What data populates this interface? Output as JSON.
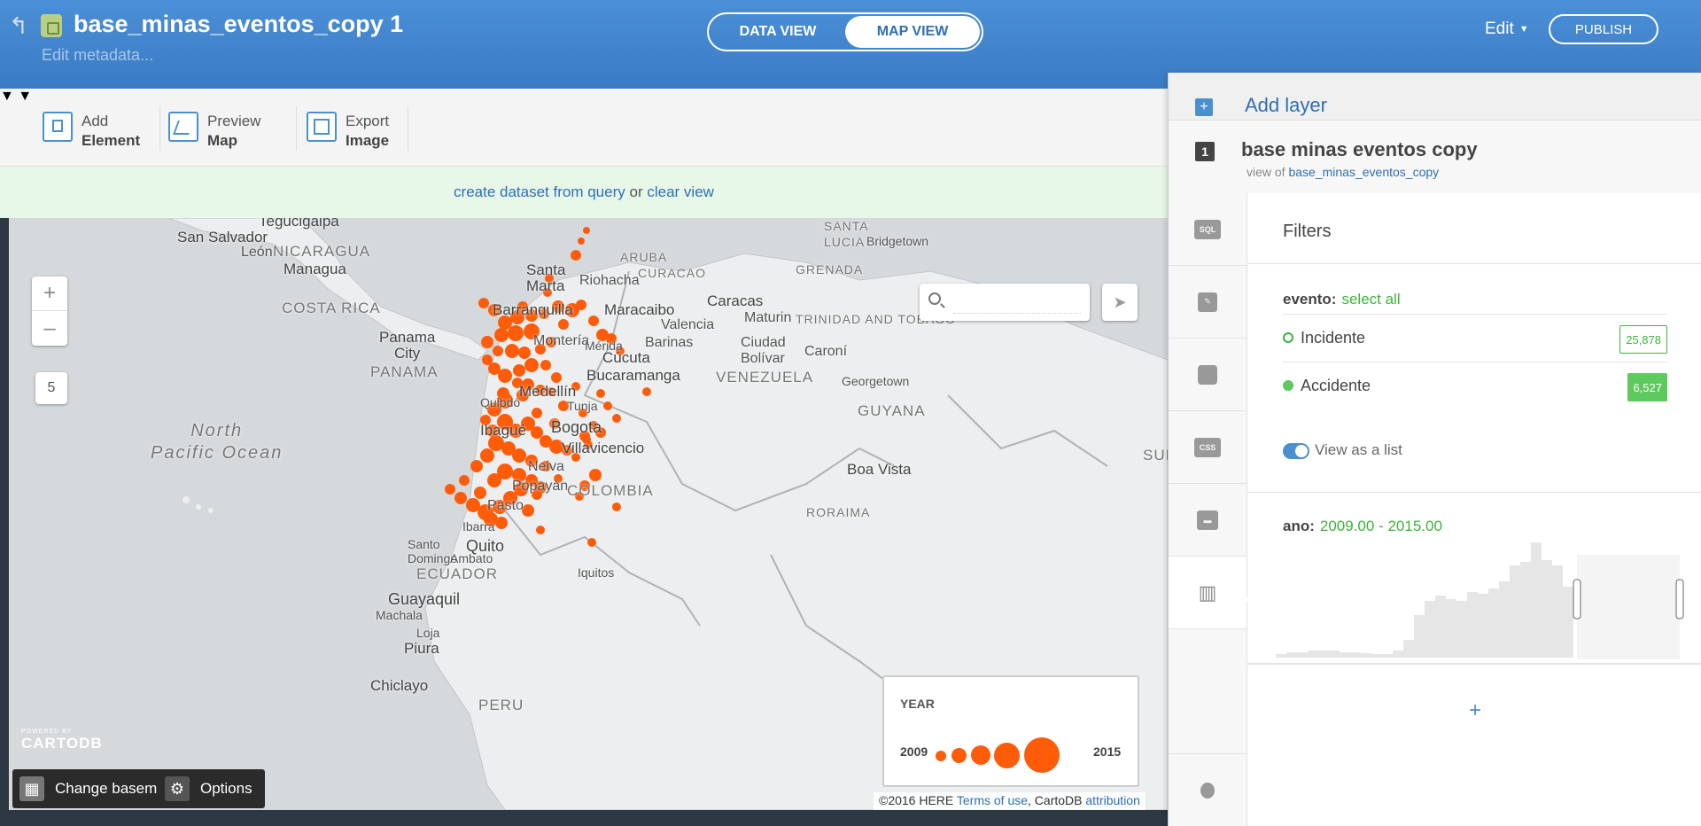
{
  "header": {
    "title": "base_minas_eventos_copy 1",
    "subtitle": "Edit metadata...",
    "tabs": [
      "DATA VIEW",
      "MAP VIEW"
    ],
    "active_tab": "MAP VIEW",
    "edit_label": "Edit",
    "publish_label": "PUBLISH"
  },
  "toolbar": {
    "add": {
      "line1": "Add",
      "line2": "Element"
    },
    "preview": {
      "line1": "Preview",
      "line2": "Map"
    },
    "export": {
      "line1": "Export",
      "line2": "Image"
    }
  },
  "banner": {
    "link1": "create dataset from query",
    "middle": "or",
    "link2": "clear view"
  },
  "map": {
    "zoom_in": "+",
    "zoom_out": "–",
    "zoom_level": "5",
    "search_placeholder": "",
    "labels": {
      "tegucigalpa": "Tegucigalpa",
      "san_salvador": "San Salvador",
      "leon": "León",
      "nicaragua": "NICARAGUA",
      "managua": "Managua",
      "costa_rica": "COSTA RICA",
      "panama_city": "Panama\nCity",
      "panama": "PANAMA",
      "north_pacific": "North\nPacific Ocean",
      "santa_marta": "Santa\nMarta",
      "riohacha": "Riohacha",
      "aruba": "ARUBA",
      "curacao": "CURACAO",
      "grenada": "GRENADA",
      "santa_lucia": "SANTA\nLUCIA",
      "bridgetown": "Bridgetown",
      "barranquilla": "Barranquilla",
      "maracaibo": "Maracaibo",
      "caracas": "Caracas",
      "maturin": "Maturin",
      "trinidad": "TRINIDAD AND TOBAGO",
      "valencia": "Valencia",
      "monteria": "Montería",
      "merida": "Mérida",
      "barinas": "Barinas",
      "ciudad_bolivar": "Ciudad\nBolívar",
      "caroni": "Caroní",
      "cucuta": "Cúcuta",
      "bucaramanga": "Bucaramanga",
      "venezuela": "VENEZUELA",
      "georgetown": "Georgetown",
      "medellin": "Medellín",
      "guyana": "GUYANA",
      "quibdo": "Quibdó",
      "tunja": "Tunja",
      "ibague": "Ibagué",
      "bogota": "Bogota",
      "villavicencio": "Villavicencio",
      "neiva": "Neiva",
      "suriname": "SURIN",
      "popayan": "Popayán",
      "colombia": "COLOMBIA",
      "boa_vista": "Boa Vista",
      "pasto": "Pasto",
      "roraima": "RORAIMA",
      "ibarra": "Ibarra",
      "quito": "Quito",
      "santo_domingo": "Santo\nDomingo",
      "ambato": "Ambato",
      "ecuador": "ECUADOR",
      "guayaquil": "Guayaquil",
      "machala": "Machala",
      "iquitos": "Iquitos",
      "loja": "Loja",
      "piura": "Piura",
      "chiclayo": "Chiclayo",
      "peru": "PERU"
    },
    "legend": {
      "title": "YEAR",
      "min": "2009",
      "max": "2015"
    },
    "powered_by": "POWERED BY",
    "cartodb_logo": "CARTODB",
    "change_basemap": "Change basemap",
    "options": "Options",
    "attribution": {
      "text1": "©2016 HERE",
      "link1": "Terms of use",
      "text2": ", CartoDB",
      "link2": "attribution"
    },
    "marker_color": "#ff5c0a"
  },
  "panel": {
    "add_layer": "Add layer",
    "layer_number": "1",
    "layer_name": "base minas eventos copy",
    "view_of_label": "view of",
    "view_of_table": "base_minas_eventos_copy",
    "side_icons": [
      "sql-icon",
      "wizard-icon",
      "infowindow-icon",
      "css-icon",
      "legend-icon",
      "filters-icon",
      "lightbulb-icon"
    ],
    "side_icon_texts": {
      "sql": "SQL",
      "css": "CSS"
    },
    "filters_title": "Filters",
    "evento_label": "evento:",
    "select_all": "select all",
    "categories": [
      {
        "name": "Incidente",
        "count": "25,878",
        "state": "unselected"
      },
      {
        "name": "Accidente",
        "count": "6,527",
        "state": "selected"
      }
    ],
    "view_as_list": "View as a list",
    "ano_label": "ano:",
    "ano_range": "2009.00 - 2015.00",
    "histogram_selected_color": "#bfe2bf",
    "histogram_unselected_color": "#e6e6e6",
    "add_filter": "+"
  }
}
